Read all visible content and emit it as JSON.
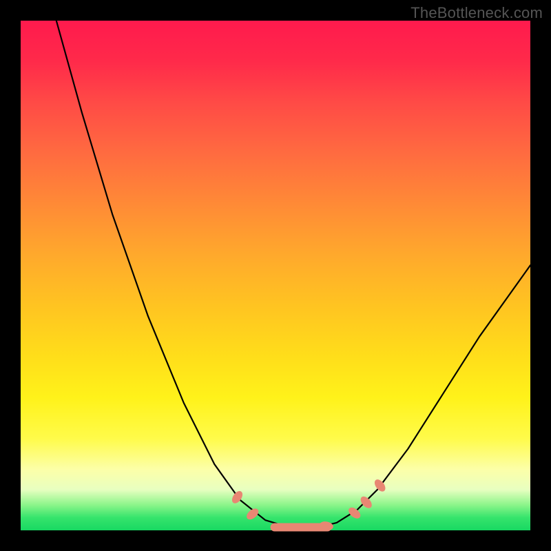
{
  "watermark": "TheBottleneck.com",
  "chart_data": {
    "type": "line",
    "title": "",
    "xlabel": "",
    "ylabel": "",
    "xlim": [
      0,
      100
    ],
    "ylim": [
      0,
      100
    ],
    "gradient_bands": [
      {
        "y": 100,
        "color": "#ff1a4d"
      },
      {
        "y": 50,
        "color": "#ffc421"
      },
      {
        "y": 10,
        "color": "#fcffa8"
      },
      {
        "y": 0,
        "color": "#18d862"
      }
    ],
    "series": [
      {
        "name": "bottleneck-curve",
        "description": "V-shaped bottleneck percentage curve",
        "points": [
          {
            "x": 7,
            "y": 100
          },
          {
            "x": 12,
            "y": 82
          },
          {
            "x": 18,
            "y": 62
          },
          {
            "x": 25,
            "y": 42
          },
          {
            "x": 32,
            "y": 25
          },
          {
            "x": 38,
            "y": 13
          },
          {
            "x": 43,
            "y": 6
          },
          {
            "x": 48,
            "y": 2
          },
          {
            "x": 53,
            "y": 0.5
          },
          {
            "x": 58,
            "y": 0.5
          },
          {
            "x": 62,
            "y": 1.5
          },
          {
            "x": 66,
            "y": 4
          },
          {
            "x": 70,
            "y": 8
          },
          {
            "x": 76,
            "y": 16
          },
          {
            "x": 83,
            "y": 27
          },
          {
            "x": 90,
            "y": 38
          },
          {
            "x": 100,
            "y": 52
          }
        ]
      }
    ],
    "markers": [
      {
        "x": 42.5,
        "y": 6.5,
        "angle": -55
      },
      {
        "x": 45.5,
        "y": 3.2,
        "angle": -40
      },
      {
        "x": 53,
        "y": 0.6,
        "angle": 0
      },
      {
        "x": 57,
        "y": 0.6,
        "angle": 0
      },
      {
        "x": 60,
        "y": 0.9,
        "angle": 12
      },
      {
        "x": 65.5,
        "y": 3.4,
        "angle": 40
      },
      {
        "x": 67.8,
        "y": 5.5,
        "angle": 48
      },
      {
        "x": 70.5,
        "y": 8.8,
        "angle": 52
      }
    ],
    "marker_long": {
      "x_start": 49,
      "x_end": 61,
      "y": 0.6
    }
  },
  "style": {
    "curve_color": "#000000",
    "curve_width": 2.2,
    "marker_fill": "#e88773",
    "marker_rx": 10,
    "marker_ry": 6,
    "frame_bg": "#000000"
  }
}
